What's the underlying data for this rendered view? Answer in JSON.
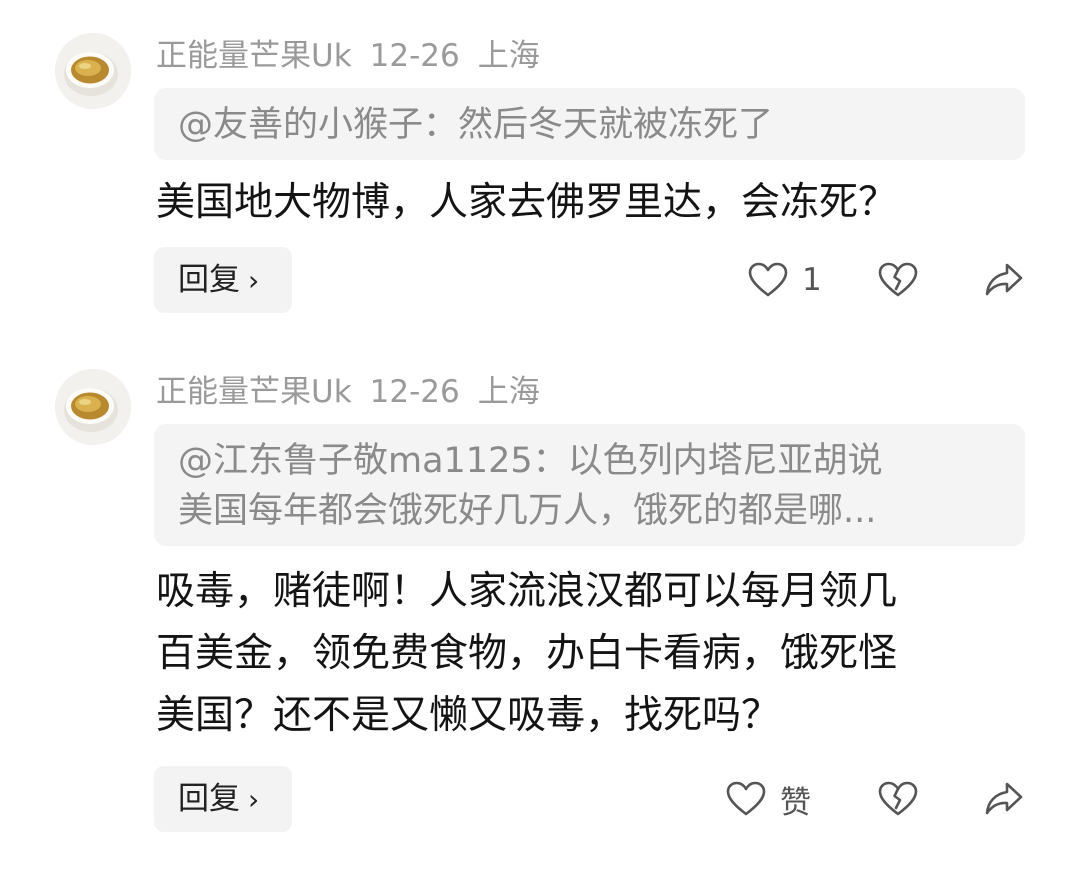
{
  "comments": [
    {
      "author": "正能量芒果Uk",
      "date": "12-26",
      "location": "上海",
      "quote_lines": [
        "@友善的小猴子：然后冬天就被冻死了"
      ],
      "body_lines": [
        "美国地大物博，人家去佛罗里达，会冻死？"
      ],
      "reply_label": "回复",
      "reply_chevron": "›",
      "like_label": "1"
    },
    {
      "author": "正能量芒果Uk",
      "date": "12-26",
      "location": "上海",
      "quote_lines": [
        "@江东鲁子敬ma1125：以色列内塔尼亚胡说",
        "美国每年都会饿死好几万人，饿死的都是哪..."
      ],
      "body_lines": [
        "吸毒，赌徒啊！人家流浪汉都可以每月领几",
        "百美金，领免费食物，办白卡看病，饿死怪",
        "美国？还不是又懒又吸毒，找死吗？"
      ],
      "reply_label": "回复",
      "reply_chevron": "›",
      "like_label": "赞"
    }
  ],
  "icons": {
    "like": "heart-outline-icon",
    "dislike": "broken-heart-icon",
    "share": "share-arrow-icon",
    "avatar": "tea-cup-avatar"
  }
}
